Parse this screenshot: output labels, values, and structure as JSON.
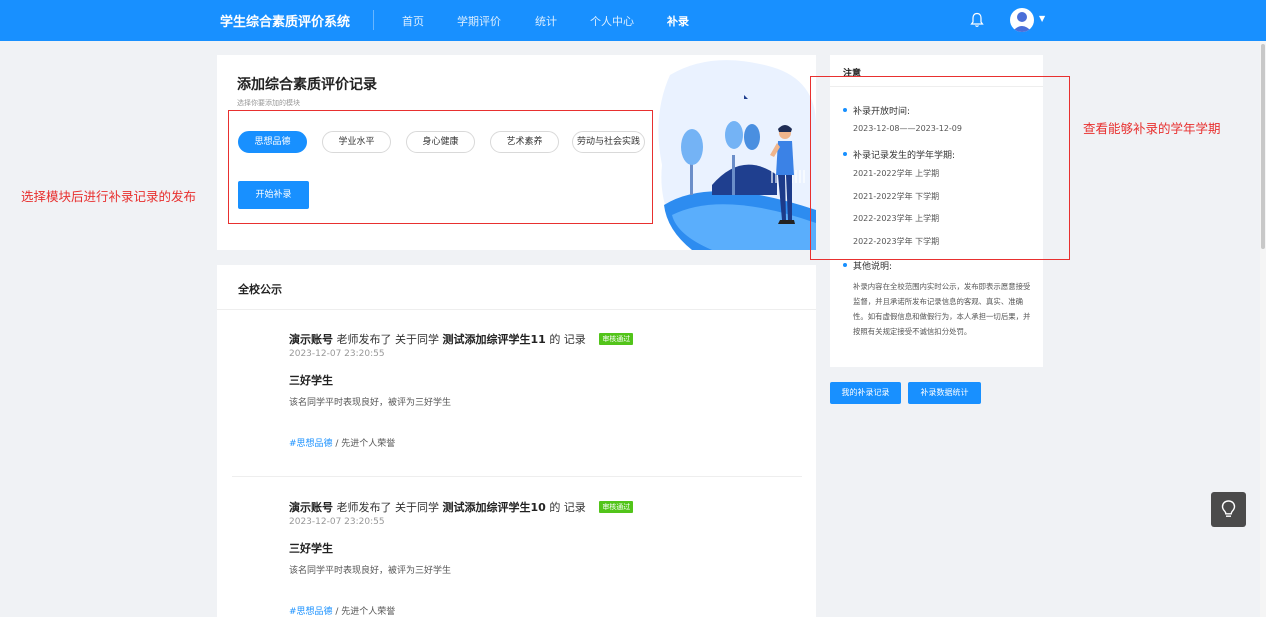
{
  "header": {
    "title": "学生综合素质评价系统",
    "nav": [
      "首页",
      "学期评价",
      "统计",
      "个人中心",
      "补录"
    ],
    "active_nav": "补录",
    "bell_icon": "bell-icon",
    "avatar_icon": "user-avatar-icon",
    "accent_color": "#1890ff"
  },
  "add_record": {
    "title": "添加综合素质评价记录",
    "subtitle": "选择你要添加的模块",
    "modules": [
      "思想品德",
      "学业水平",
      "身心健康",
      "艺术素养",
      "劳动与社会实践"
    ],
    "selected_module": "思想品德",
    "start_button": "开始补录"
  },
  "notice_board": {
    "title": "全校公示",
    "posts": [
      {
        "account": "演示账号",
        "mid": "老师发布了 关于同学",
        "student": "测试添加综评学生11",
        "tail": "的 记录",
        "badge": "审核通过",
        "time": "2023-12-07 23:20:55",
        "heading": "三好学生",
        "body": "该名同学平时表现良好，被评为三好学生",
        "tag": "#思想品德",
        "category": " / 先进个人荣誉"
      },
      {
        "account": "演示账号",
        "mid": "老师发布了 关于同学",
        "student": "测试添加综评学生10",
        "tail": "的 记录",
        "badge": "审核通过",
        "time": "2023-12-07 23:20:55",
        "heading": "三好学生",
        "body": "该名同学平时表现良好，被评为三好学生",
        "tag": "#思想品德",
        "category": " / 先进个人荣誉"
      }
    ]
  },
  "sidebar": {
    "title": "注意",
    "open_time_label": "补录开放时间:",
    "open_time": "2023-12-08——2023-12-09",
    "semesters_label": "补录记录发生的学年学期:",
    "semesters": [
      "2021-2022学年 上学期",
      "2021-2022学年 下学期",
      "2022-2023学年 上学期",
      "2022-2023学年 下学期"
    ],
    "other_label": "其他说明:",
    "other_text": "补录内容在全校范围内实时公示，发布即表示愿意接受监督，并且承诺所发布记录信息的客观、真实、准确性。如有虚假信息和做假行为，本人承担一切后果，并按照有关规定接受不诚信扣分处罚。",
    "buttons": [
      "我的补录记录",
      "补录数据统计"
    ]
  },
  "annotations": {
    "left": "选择模块后进行补录记录的发布",
    "right": "查看能够补录的学年学期",
    "color": "#e8302f"
  },
  "float_button_icon": "lightbulb-icon"
}
